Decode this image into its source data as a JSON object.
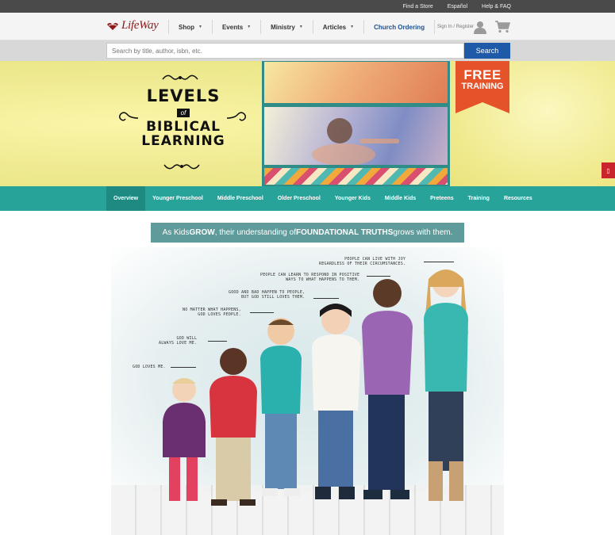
{
  "utility": {
    "links": [
      "Find a Store",
      "Español",
      "Help & FAQ"
    ]
  },
  "brand": {
    "logo_text": "LifeWay",
    "color": "#8e1b1b"
  },
  "nav": {
    "items": [
      {
        "label": "Shop",
        "has_dropdown": true
      },
      {
        "label": "Events",
        "has_dropdown": true
      },
      {
        "label": "Ministry",
        "has_dropdown": true
      },
      {
        "label": "Articles",
        "has_dropdown": true
      },
      {
        "label": "Church Ordering",
        "has_dropdown": false
      }
    ],
    "signin_label": "Sign In / Register",
    "icons": [
      "user-icon",
      "cart-icon"
    ]
  },
  "search": {
    "placeholder": "Search by title, author, isbn, etc.",
    "button_label": "Search"
  },
  "hero": {
    "title_line1": "LEVELS",
    "title_line2": "of",
    "title_line3": "BIBLICAL",
    "title_line4": "LEARNING",
    "banner_line1": "FREE",
    "banner_line2": "TRAINING",
    "side_tab_icon": "gift-icon"
  },
  "subnav": {
    "items": [
      {
        "label": "Overview",
        "active": true
      },
      {
        "label": "Younger Preschool",
        "active": false
      },
      {
        "label": "Middle Preschool",
        "active": false
      },
      {
        "label": "Older Preschool",
        "active": false
      },
      {
        "label": "Younger Kids",
        "active": false
      },
      {
        "label": "Middle Kids",
        "active": false
      },
      {
        "label": "Preteens",
        "active": false
      },
      {
        "label": "Training",
        "active": false
      },
      {
        "label": "Resources",
        "active": false
      }
    ]
  },
  "tagline": {
    "part1": "As Kids ",
    "grow": "GROW",
    "part2": ", their understanding of ",
    "truths": "FOUNDATIONAL TRUTHS",
    "part3": " grows with them."
  },
  "annotations": [
    "GOD LOVES ME.",
    "GOD WILL\nALWAYS LOVE ME.",
    "NO MATTER WHAT HAPPENS,\nGOD LOVES PEOPLE.",
    "GOOD AND BAD HAPPEN TO PEOPLE,\nBUT GOD STILL LOVES THEM.",
    "PEOPLE CAN LEARN TO RESPOND IN POSITIVE\nWAYS TO WHAT HAPPENS TO THEM.",
    "PEOPLE CAN LIVE WITH JOY\nREGARDLESS OF THEIR CIRCUMSTANCES."
  ],
  "colors": {
    "teal": "#27a39a",
    "search_blue": "#1e5aa8",
    "banner_orange": "#e5532a",
    "tagline_bg": "#5f9b9a"
  }
}
